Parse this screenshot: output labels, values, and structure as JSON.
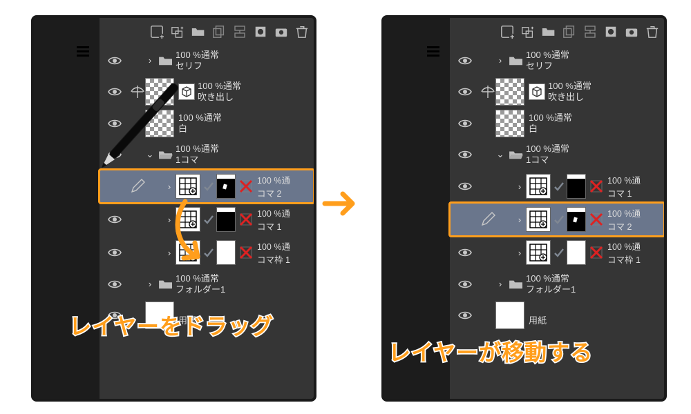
{
  "annotations": {
    "left_caption": "レイヤーをドラッグ",
    "right_caption": "レイヤーが移動する"
  },
  "common": {
    "blend_normal_100": "100 %通常",
    "blend_trunc_100": "100 %通"
  },
  "left_panel": {
    "layers": {
      "serif": {
        "name": "セリフ"
      },
      "balloon": {
        "name": "吹き出し"
      },
      "white": {
        "name": "白"
      },
      "koma_group": {
        "name": "1コマ"
      },
      "frame_a": {
        "name": "コマ 2"
      },
      "frame_b": {
        "name": "コマ 1"
      },
      "frame_c": {
        "name": "コマ枠 1"
      },
      "folder1": {
        "name": "フォルダー1"
      },
      "paper": {
        "name": "用紙"
      }
    },
    "selected": "frame_a"
  },
  "right_panel": {
    "layers": {
      "serif": {
        "name": "セリフ"
      },
      "balloon": {
        "name": "吹き出し"
      },
      "white": {
        "name": "白"
      },
      "koma_group": {
        "name": "1コマ"
      },
      "frame_a": {
        "name": "コマ 1"
      },
      "frame_b": {
        "name": "コマ 2"
      },
      "frame_c": {
        "name": "コマ枠 1"
      },
      "folder1": {
        "name": "フォルダー1"
      },
      "paper": {
        "name": "用紙"
      }
    },
    "selected": "frame_b"
  }
}
